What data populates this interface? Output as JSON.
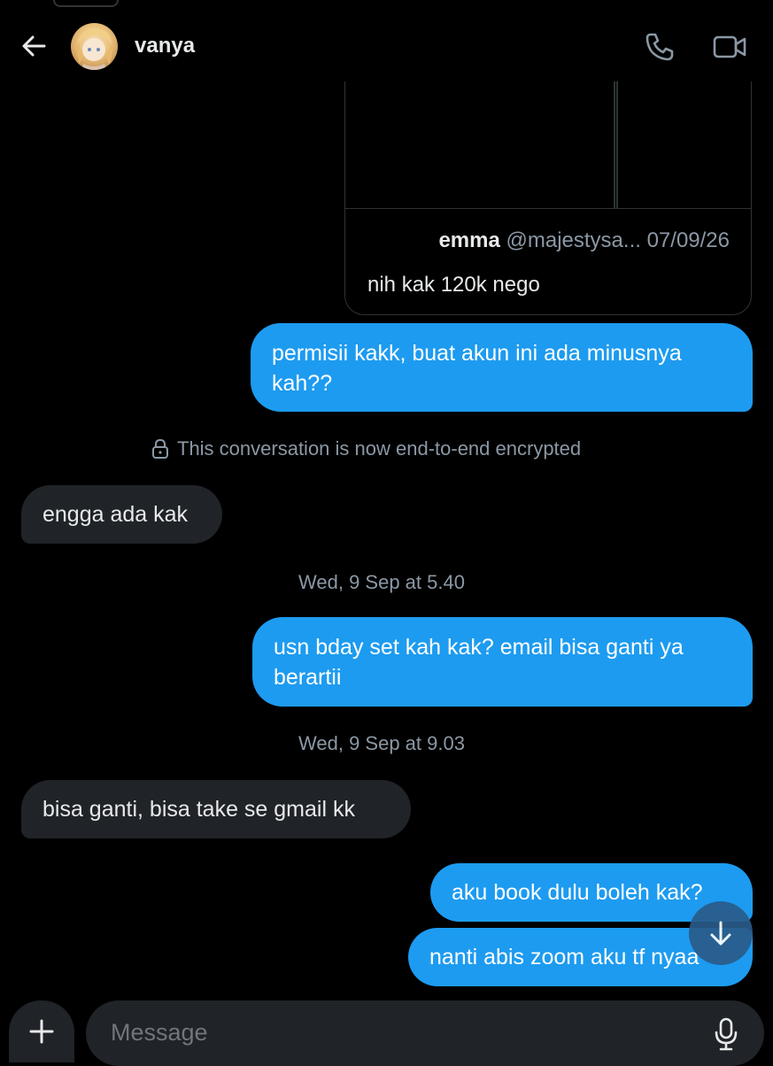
{
  "header": {
    "contact_name": "vanya",
    "back_icon": "arrow-left-icon",
    "call_icon": "phone-icon",
    "video_icon": "video-camera-icon"
  },
  "shared_post": {
    "author_name": "emma",
    "author_handle": "@majestysa...",
    "date": "07/09/26",
    "caption": "nih kak 120k nego"
  },
  "messages": [
    {
      "direction": "outgoing",
      "text": "permisii kakk, buat akun ini ada minusnya kah??"
    },
    {
      "direction": "incoming",
      "text": "engga ada kak"
    },
    {
      "direction": "outgoing",
      "text": "usn bday set kah kak? email bisa ganti ya berartii"
    },
    {
      "direction": "incoming",
      "text": "bisa ganti, bisa take se gmail kk"
    },
    {
      "direction": "outgoing",
      "text": "aku book dulu boleh kak?"
    },
    {
      "direction": "outgoing",
      "text": "nanti abis zoom aku tf nyaa"
    }
  ],
  "notices": {
    "encryption": "This conversation is now end-to-end encrypted",
    "timestamp_1": "Wed, 9 Sep at 5.40",
    "timestamp_2": "Wed, 9 Sep at 9.03"
  },
  "composer": {
    "placeholder": "Message",
    "add_icon": "plus-icon",
    "mic_icon": "microphone-icon",
    "scroll_icon": "arrow-down-icon"
  },
  "colors": {
    "background": "#000000",
    "outgoing_bubble": "#1d9bf0",
    "incoming_bubble": "#202327",
    "secondary_text": "#8b98a5"
  }
}
